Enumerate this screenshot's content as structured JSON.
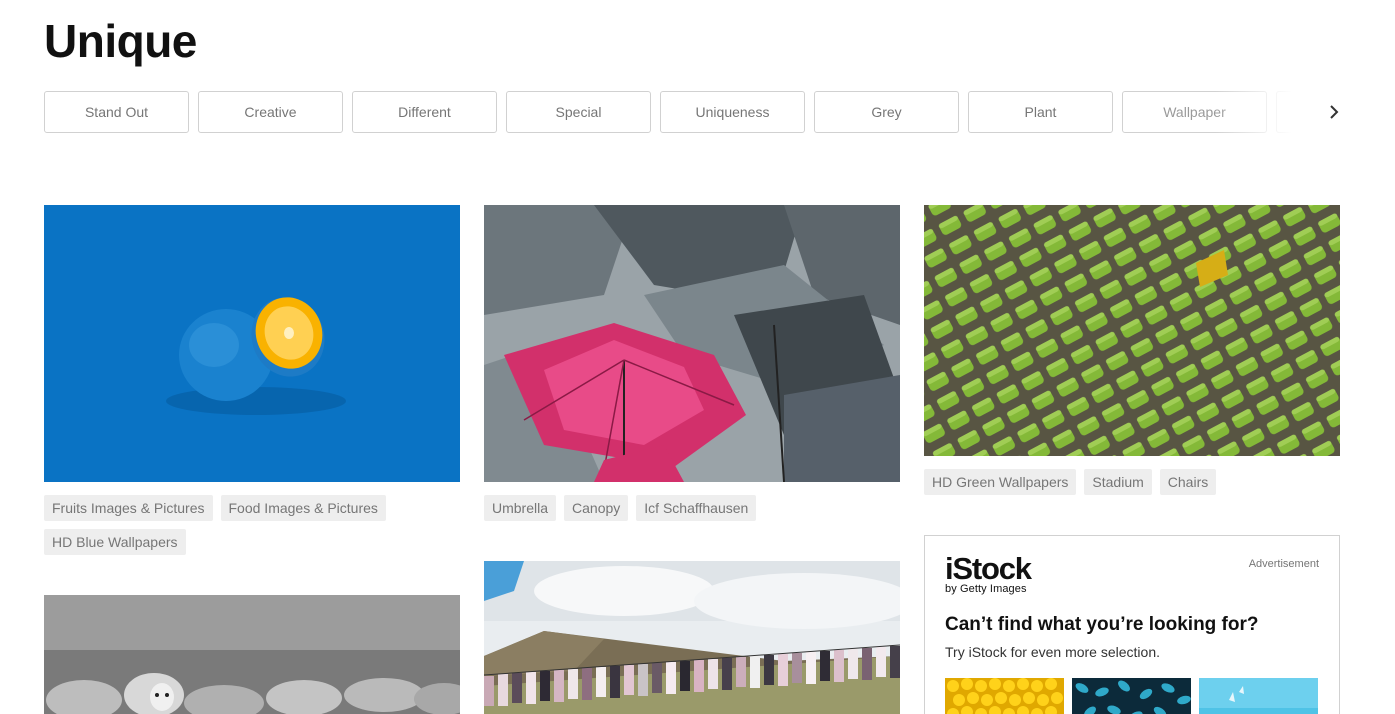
{
  "page": {
    "title": "Unique"
  },
  "related_searches": [
    "Stand Out",
    "Creative",
    "Different",
    "Special",
    "Uniqueness",
    "Grey",
    "Plant",
    "Wallpaper",
    ""
  ],
  "photos": {
    "orange": {
      "alt_icon": "blue-orange-photo",
      "tags": [
        "Fruits Images & Pictures",
        "Food Images & Pictures",
        "HD Blue Wallpapers"
      ]
    },
    "umbrellas": {
      "alt_icon": "umbrellas-photo",
      "tags": [
        "Umbrella",
        "Canopy",
        "Icf Schaffhausen"
      ]
    },
    "stadium": {
      "alt_icon": "stadium-seats-photo",
      "tags": [
        "HD Green Wallpapers",
        "Stadium",
        "Chairs"
      ]
    },
    "sheep": {
      "alt_icon": "sheep-photo"
    },
    "clothesline": {
      "alt_icon": "clothesline-photo"
    }
  },
  "ad": {
    "logo": "iStock",
    "logo_sub": "by Getty Images",
    "label": "Advertisement",
    "heading": "Can’t find what you’re looking for?",
    "subtext": "Try iStock for even more selection."
  },
  "colors": {
    "chip_border": "#d1d1d1",
    "tag_bg": "#eeeeee",
    "text_muted": "#767676"
  }
}
